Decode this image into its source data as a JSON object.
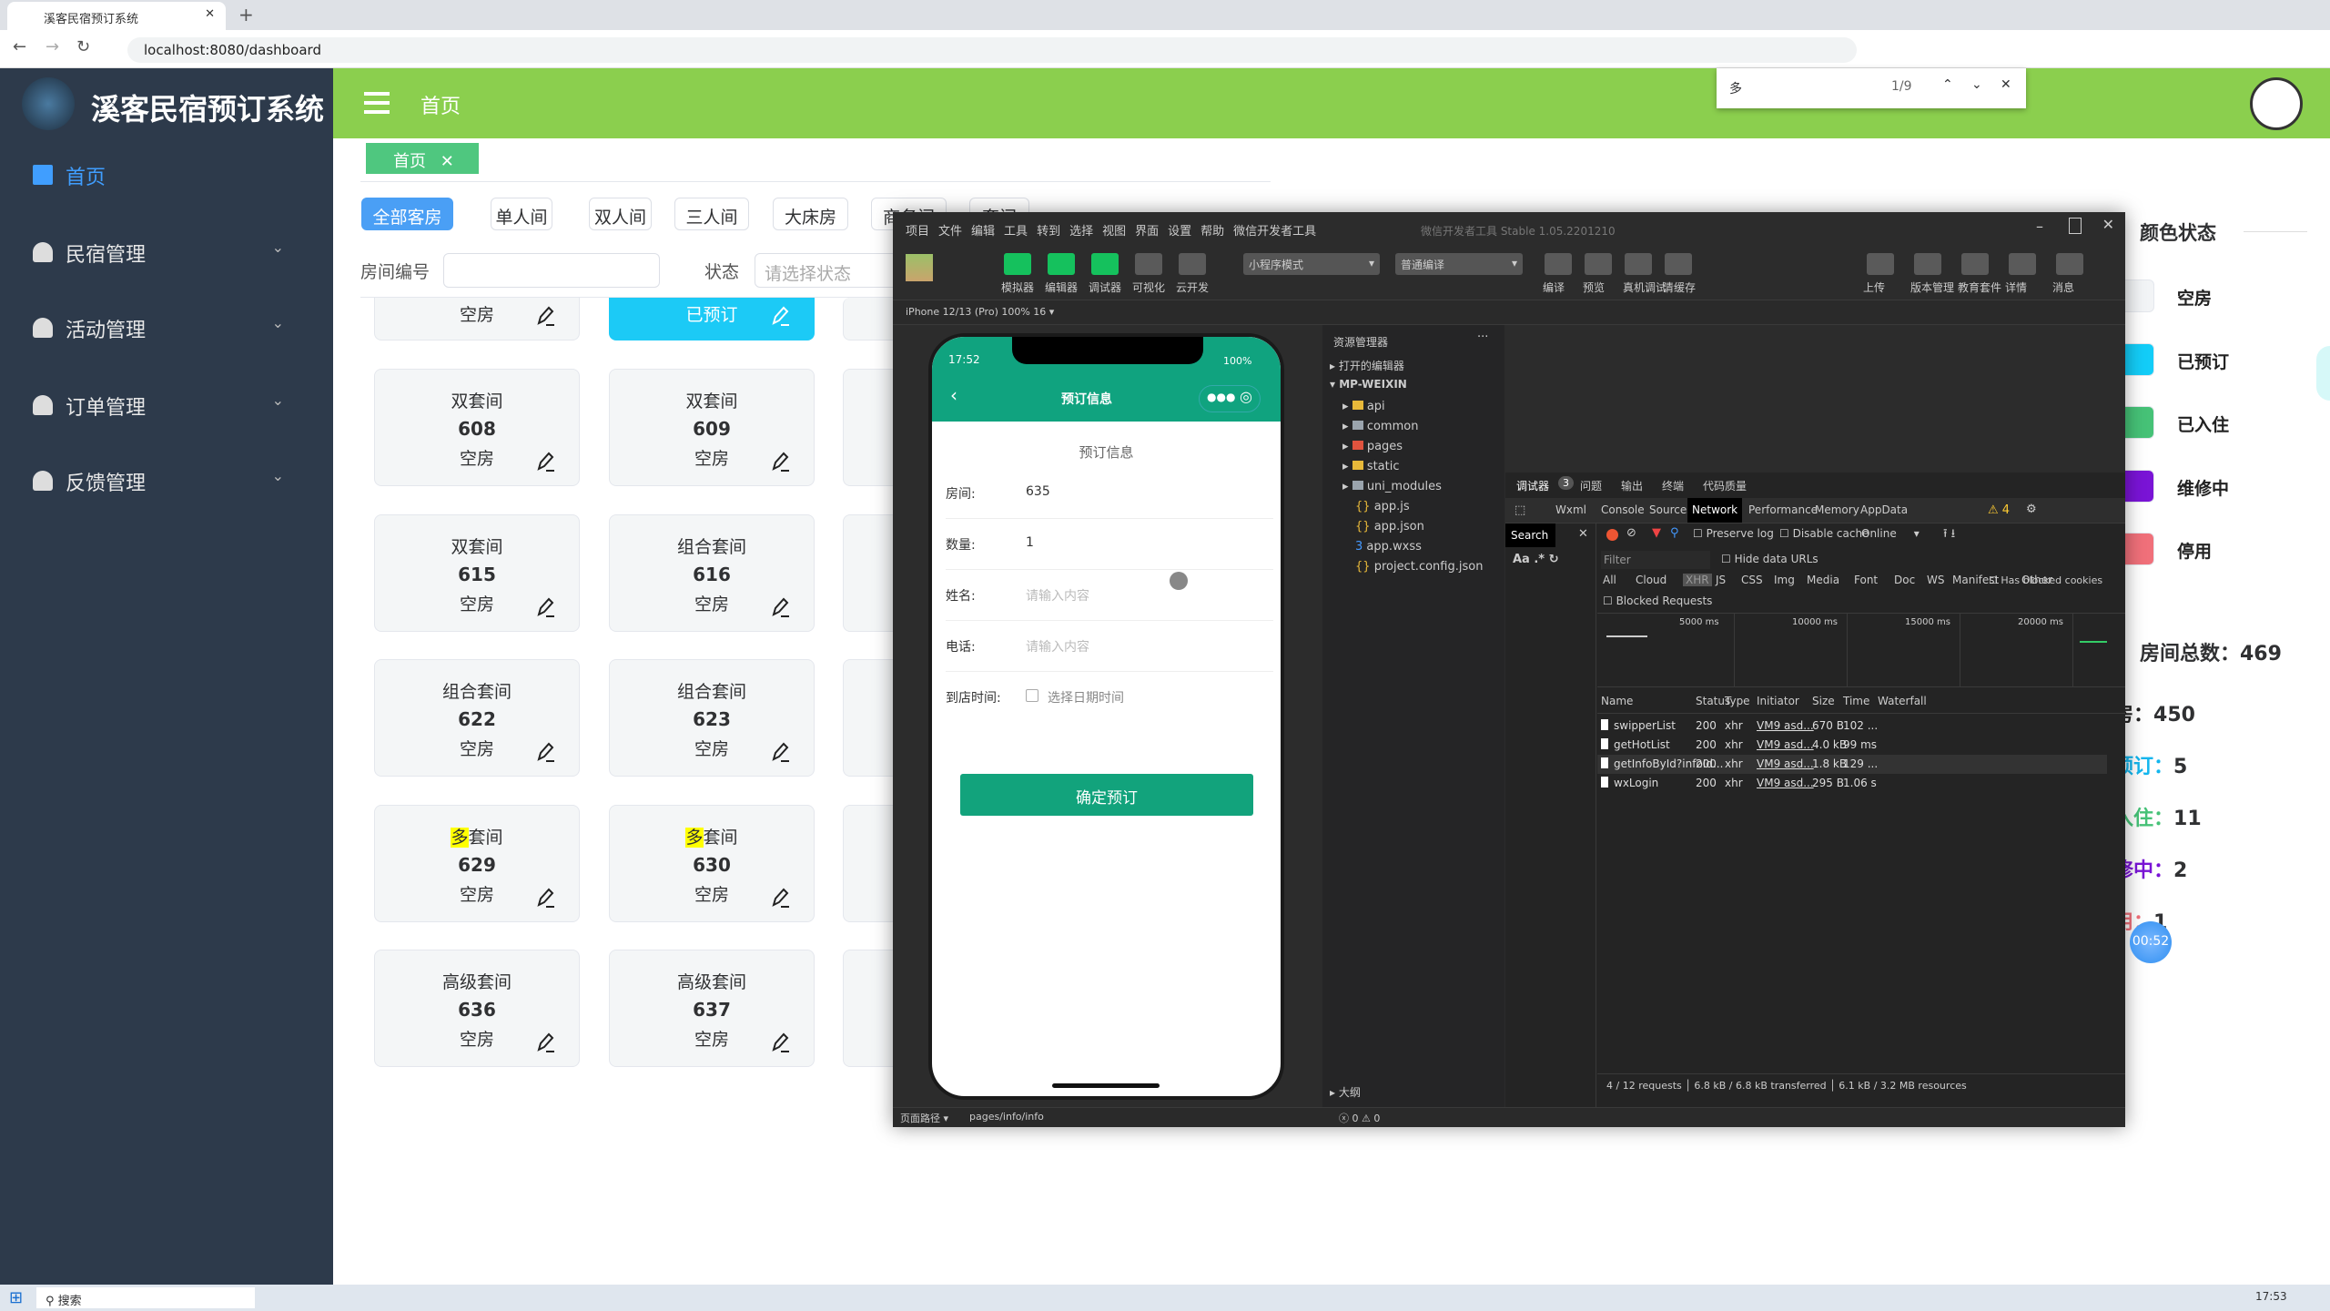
{
  "browser": {
    "tab_title": "溪客民宿预订系统",
    "url": "localhost:8080/dashboard",
    "find_count": "1/9",
    "find_query": "多"
  },
  "app": {
    "title": "溪客民宿预订系统",
    "header_title": "首页",
    "active_tag": "首页",
    "sidebar": [
      {
        "label": "首页",
        "icon": "home-icon",
        "active": true
      },
      {
        "label": "民宿管理",
        "icon": "user-icon"
      },
      {
        "label": "活动管理",
        "icon": "user-icon"
      },
      {
        "label": "订单管理",
        "icon": "user-icon"
      },
      {
        "label": "反馈管理",
        "icon": "user-icon"
      }
    ],
    "filters": [
      "全部客房",
      "单人间",
      "双人间",
      "三人间",
      "大床房",
      "商务间",
      "套间"
    ],
    "search": {
      "room_label": "房间编号",
      "room_value": "",
      "status_label": "状态",
      "status_placeholder": "请选择状态"
    },
    "partial_row": [
      {
        "status": "空房",
        "color": "#f4f6f7"
      },
      {
        "status": "已预订",
        "color": "#1ccaf6"
      }
    ],
    "rooms": [
      [
        {
          "type": "双套间",
          "no": "608",
          "status": "空房"
        },
        {
          "type": "双套间",
          "no": "609",
          "status": "空房"
        }
      ],
      [
        {
          "type": "双套间",
          "no": "615",
          "status": "空房"
        },
        {
          "type": "组合套间",
          "no": "616",
          "status": "空房"
        }
      ],
      [
        {
          "type": "组合套间",
          "no": "622",
          "status": "空房"
        },
        {
          "type": "组合套间",
          "no": "623",
          "status": "空房"
        }
      ],
      [
        {
          "type": "多套间",
          "no": "629",
          "status": "空房",
          "hl": "多",
          "rest": "套间"
        },
        {
          "type": "多套间",
          "no": "630",
          "status": "空房",
          "hl": "多",
          "rest": "套间"
        }
      ],
      [
        {
          "type": "高级套间",
          "no": "636",
          "status": "空房"
        },
        {
          "type": "高级套间",
          "no": "637",
          "status": "空房"
        }
      ]
    ],
    "legend_title": "颜色状态",
    "legend": [
      {
        "label": "空房",
        "color": "#f2f4f6"
      },
      {
        "label": "已预订",
        "color": "#13cdf8"
      },
      {
        "label": "已入住",
        "color": "#46c277"
      },
      {
        "label": "维修中",
        "color": "#7a14d6"
      },
      {
        "label": "停用",
        "color": "#f0707a"
      }
    ],
    "total": "房间总数：469",
    "stats": [
      {
        "label": "空房：",
        "value": "450",
        "color": "#222"
      },
      {
        "label": "已预订：",
        "value": "5",
        "color": "#13b6ee"
      },
      {
        "label": "已入住：",
        "value": "11",
        "color": "#46c277"
      },
      {
        "label": "维修中：",
        "value": "2",
        "color": "#7a14d6"
      },
      {
        "label": "停用：",
        "value": "1",
        "color": "#f0707a"
      }
    ],
    "timer": "00:52"
  },
  "devtools": {
    "menu": [
      "项目",
      "文件",
      "编辑",
      "工具",
      "转到",
      "选择",
      "视图",
      "界面",
      "设置",
      "帮助",
      "微信开发者工具"
    ],
    "title": "微信开发者工具 Stable 1.05.2201210",
    "left_tools": [
      "模拟器",
      "编辑器",
      "调试器",
      "可视化",
      "云开发"
    ],
    "mode": "小程序模式",
    "compile": "普通编译",
    "mid_tools": [
      "编译",
      "预览",
      "真机调试",
      "清缓存"
    ],
    "right_tools": [
      "上传",
      "版本管理",
      "教育套件",
      "详情",
      "消息"
    ],
    "device": "iPhone 12/13 (Pro) 100% 16 ▾",
    "phone": {
      "time": "17:52",
      "battery": "100%",
      "nav_title": "预订信息",
      "section": "预订信息",
      "fields": [
        {
          "label": "房间:",
          "value": "635"
        },
        {
          "label": "数量:",
          "value": "1"
        },
        {
          "label": "姓名:",
          "placeholder": "请输入内容"
        },
        {
          "label": "电话:",
          "placeholder": "请输入内容"
        }
      ],
      "date_label": "到店时间:",
      "date_placeholder": "选择日期时间",
      "submit": "确定预订"
    },
    "explorer": {
      "title": "资源管理器",
      "open_editors": "打开的编辑器",
      "root": "MP-WEIXIN",
      "items": [
        "api",
        "common",
        "pages",
        "static",
        "uni_modules",
        "app.js",
        "app.json",
        "app.wxss",
        "project.config.json"
      ],
      "outline": "大纲"
    },
    "debug_tabs": [
      "调试器",
      "问题",
      "输出",
      "终端",
      "代码质量"
    ],
    "debug_badge": "3",
    "panels": [
      "Wxml",
      "Console",
      "Sources",
      "Network",
      "Performance",
      "Memory",
      "AppData"
    ],
    "warnings": "4",
    "search_tab": "Search",
    "preserve_log": "Preserve log",
    "disable_cache": "Disable cache",
    "throttle": "Online",
    "filter_placeholder": "Filter",
    "hide_data_urls": "Hide data URLs",
    "types": [
      "All",
      "Cloud",
      "XHR",
      "JS",
      "CSS",
      "Img",
      "Media",
      "Font",
      "Doc",
      "WS",
      "Manifest",
      "Other"
    ],
    "blocked_cookies": "Has blocked cookies",
    "blocked_requests": "Blocked Requests",
    "timeline": [
      "5000 ms",
      "10000 ms",
      "15000 ms",
      "20000 ms"
    ],
    "columns": [
      "Name",
      "Status",
      "Type",
      "Initiator",
      "Size",
      "Time",
      "Waterfall"
    ],
    "requests": [
      [
        "swipperList",
        "200",
        "xhr",
        "VM9 asd...",
        "670 B",
        "102 ..."
      ],
      [
        "getHotList",
        "200",
        "xhr",
        "VM9 asd...",
        "4.0 kB",
        "99 ms"
      ],
      [
        "getInfoById?infoId...",
        "200",
        "xhr",
        "VM9 asd...",
        "1.8 kB",
        "129 ..."
      ],
      [
        "wxLogin",
        "200",
        "xhr",
        "VM9 asd...",
        "295 B",
        "1.06 s"
      ]
    ],
    "summary": [
      "4 / 12 requests",
      "6.8 kB / 6.8 kB transferred",
      "6.1 kB / 3.2 MB resources"
    ],
    "page_path_label": "页面路径 ▾",
    "page_path": "pages/info/info",
    "errors": "ⓧ 0 ⚠ 0"
  },
  "taskbar": {
    "search": "搜索",
    "time": "17:53"
  }
}
